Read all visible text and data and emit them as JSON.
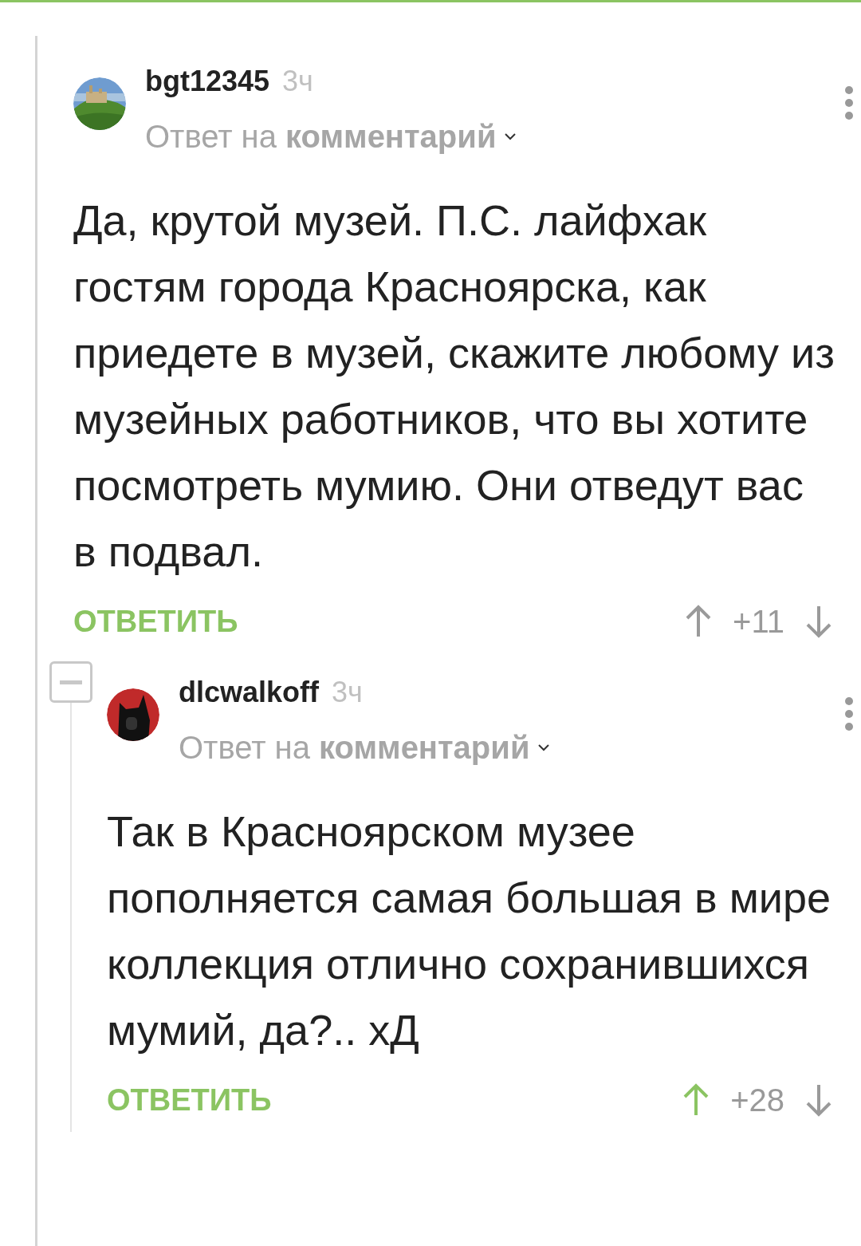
{
  "comments": [
    {
      "author": "bgt12345",
      "time": "3ч",
      "reply_to": "Ответ на **комментарий**",
      "text": "Да, крутой музей. П.С. лайфхак гостям города Красноярска, как приедете в музей, скажите любому из музейных работников, что вы хотите посмотреть мумию. Они отведут вас в подвал.",
      "reply_label": "ОТВЕТИТЬ",
      "rating": "+11",
      "upvoted": false,
      "expanded": true,
      "children": [
        {
          "author": "dlcwalkoff",
          "time": "3ч",
          "reply_to": "Ответ на **комментарий**",
          "text": "Так в Красноярском музее пополняется самая большая в мире коллекция отлично сохранившихся мумий, да?.. хД",
          "reply_label": "ОТВЕТИТЬ",
          "rating": "+28",
          "upvoted": true
        }
      ]
    }
  ]
}
